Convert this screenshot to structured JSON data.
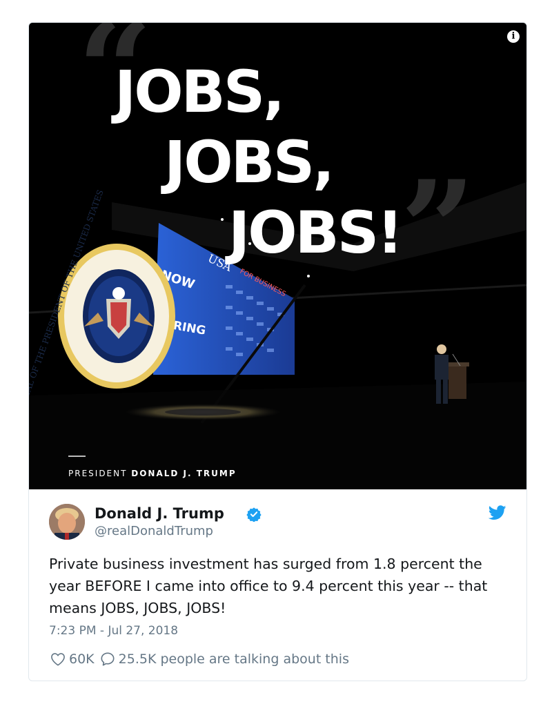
{
  "media": {
    "headline_lines": [
      "JOBS,",
      "JOBS,",
      "JOBS!"
    ],
    "caption_prefix": "PRESIDENT ",
    "caption_name": "DONALD J. TRUMP",
    "screen_text": {
      "usa": "USA",
      "now": "NOW",
      "hiring": "HIRING"
    },
    "seal_text": "SEAL OF THE PRESIDENT OF THE UNITED STATES",
    "info_icon": "info-icon"
  },
  "tweet": {
    "author_name": "Donald J. Trump",
    "handle": "@realDonaldTrump",
    "text": "Private business investment has surged from 1.8 percent the year BEFORE I came into office to 9.4 percent this year -- that means JOBS, JOBS, JOBS!",
    "timestamp": "7:23 PM - Jul 27, 2018",
    "likes": "60K",
    "conversation": "25.5K people are talking about this",
    "icons": {
      "verified": "verified-badge-icon",
      "brand": "twitter-bird-icon",
      "like": "heart-icon",
      "reply": "speech-bubble-icon"
    },
    "colors": {
      "brand": "#1da1f2",
      "text": "#14171a",
      "secondary": "#657786"
    }
  }
}
